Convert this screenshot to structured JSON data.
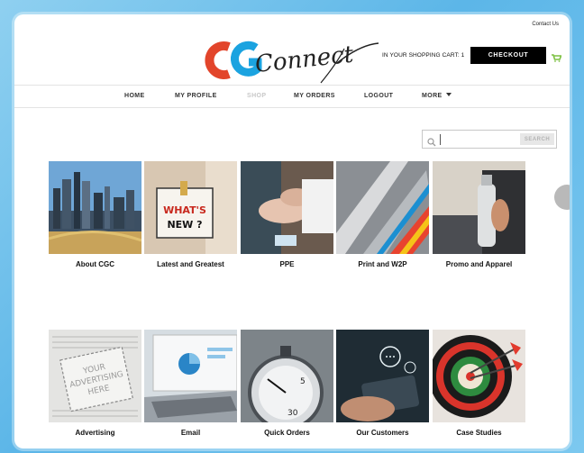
{
  "header": {
    "contact_link": "Contact Us",
    "logo_letters": "CG",
    "logo_script": "Connect",
    "cart_text": "IN YOUR SHOPPING CART: 1",
    "checkout_label": "CHECKOUT"
  },
  "nav": {
    "items": [
      {
        "label": "HOME"
      },
      {
        "label": "MY PROFILE"
      },
      {
        "label": "SHOP"
      },
      {
        "label": "MY ORDERS"
      },
      {
        "label": "LOGOUT"
      },
      {
        "label": "MORE"
      }
    ]
  },
  "search": {
    "value": "",
    "placeholder": "",
    "button_label": "SEARCH"
  },
  "tiles": {
    "items": [
      {
        "label": "About CGC"
      },
      {
        "label": "Latest and Greatest",
        "sign_text": "WHAT'S NEW ?"
      },
      {
        "label": "PPE"
      },
      {
        "label": "Print and W2P"
      },
      {
        "label": "Promo and Apparel"
      },
      {
        "label": "Advertising",
        "ad_text": "YOUR ADVERTISING HERE"
      },
      {
        "label": "Email"
      },
      {
        "label": "Quick Orders"
      },
      {
        "label": "Our Customers"
      },
      {
        "label": "Case Studies"
      }
    ]
  },
  "colors": {
    "logo_red": "#e2452b",
    "logo_blue": "#1ba3e0",
    "checkout_bg": "#000000",
    "cart_icon": "#7dc142",
    "background": "#6cc0ec"
  },
  "icons": {
    "cart": "cart-icon",
    "search": "search-icon",
    "more": "caret-down-icon"
  }
}
